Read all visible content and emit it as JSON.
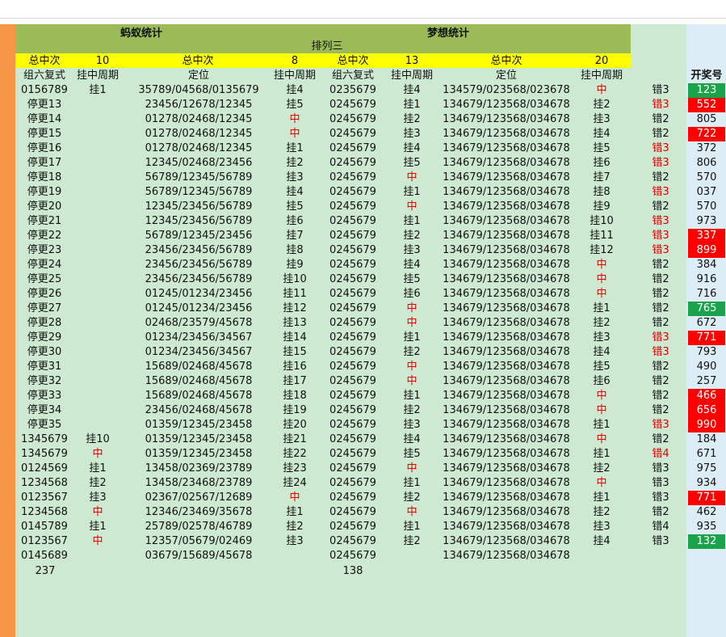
{
  "title_left": "蚂蚁统计",
  "title_right": "梦想统计",
  "subtitle": "排列三",
  "summary": {
    "left_total_label": "总中次",
    "left_total_value": "10",
    "mid_total_label": "总中次",
    "mid_total_value": "8",
    "right_total_label": "总中次",
    "right_total_value": "13",
    "far_total_label": "总中次",
    "far_total_value": "20"
  },
  "headers": [
    "组六复式",
    "挂中周期",
    "定位",
    "挂中周期",
    "组六复式",
    "挂中周期",
    "定位",
    "挂中周期",
    "",
    "开奖号"
  ],
  "rows": [
    [
      "0156789",
      "挂1",
      "35789/04568/0135679",
      "挂4",
      "0235679",
      "挂4",
      "134579/023568/023678",
      "中",
      "错3",
      "123"
    ],
    [
      "停更13",
      "",
      "23456/12678/12345",
      "挂5",
      "0245679",
      "挂1",
      "134679/123568/034678",
      "挂2",
      "错3",
      "552"
    ],
    [
      "停更14",
      "",
      "01278/02468/12345",
      "中",
      "0245679",
      "挂2",
      "134679/123568/034678",
      "挂3",
      "错2",
      "805"
    ],
    [
      "停更15",
      "",
      "01278/02468/12345",
      "中",
      "0245679",
      "挂3",
      "134679/123568/034678",
      "挂4",
      "错2",
      "722"
    ],
    [
      "停更16",
      "",
      "01278/02468/12345",
      "挂1",
      "0245679",
      "挂4",
      "134679/123568/034678",
      "挂5",
      "错3",
      "372"
    ],
    [
      "停更17",
      "",
      "12345/02468/23456",
      "挂2",
      "0245679",
      "挂5",
      "134679/123568/034678",
      "挂6",
      "错3",
      "806"
    ],
    [
      "停更18",
      "",
      "56789/12345/56789",
      "挂3",
      "0245679",
      "中",
      "134679/123568/034678",
      "挂7",
      "错2",
      "570"
    ],
    [
      "停更19",
      "",
      "56789/12345/56789",
      "挂4",
      "0245679",
      "挂1",
      "134679/123568/034678",
      "挂8",
      "错3",
      "037"
    ],
    [
      "停更20",
      "",
      "12345/23456/56789",
      "挂5",
      "0245679",
      "中",
      "134679/123568/034678",
      "挂9",
      "错2",
      "570"
    ],
    [
      "停更21",
      "",
      "12345/23456/56789",
      "挂6",
      "0245679",
      "挂1",
      "134679/123568/034678",
      "挂10",
      "错3",
      "973"
    ],
    [
      "停更22",
      "",
      "56789/12345/23456",
      "挂7",
      "0245679",
      "挂2",
      "134679/123568/034678",
      "挂11",
      "错3",
      "337"
    ],
    [
      "停更23",
      "",
      "23456/23456/56789",
      "挂8",
      "0245679",
      "挂3",
      "134679/123568/034678",
      "挂12",
      "错3",
      "899"
    ],
    [
      "停更24",
      "",
      "23456/23456/56789",
      "挂9",
      "0245679",
      "挂4",
      "134679/123568/034678",
      "中",
      "错2",
      "384"
    ],
    [
      "停更25",
      "",
      "23456/23456/56789",
      "挂10",
      "0245679",
      "挂5",
      "134679/123568/034678",
      "中",
      "错2",
      "916"
    ],
    [
      "停更26",
      "",
      "01245/01234/23456",
      "挂11",
      "0245679",
      "挂6",
      "134679/123568/034678",
      "中",
      "错2",
      "716"
    ],
    [
      "停更27",
      "",
      "01245/01234/23456",
      "挂12",
      "0245679",
      "中",
      "134679/123568/034678",
      "挂1",
      "错2",
      "765"
    ],
    [
      "停更28",
      "",
      "02468/23579/45678",
      "挂13",
      "0245679",
      "中",
      "134679/123568/034678",
      "挂2",
      "错2",
      "672"
    ],
    [
      "停更29",
      "",
      "01234/23456/34567",
      "挂14",
      "0245679",
      "挂1",
      "134679/123568/034678",
      "挂3",
      "错3",
      "771"
    ],
    [
      "停更30",
      "",
      "01234/23456/34567",
      "挂15",
      "0245679",
      "挂2",
      "134679/123568/034678",
      "挂4",
      "错3",
      "793"
    ],
    [
      "停更31",
      "",
      "15689/02468/45678",
      "挂16",
      "0245679",
      "中",
      "134679/123568/034678",
      "挂5",
      "错2",
      "490"
    ],
    [
      "停更32",
      "",
      "15689/02468/45678",
      "挂17",
      "0245679",
      "中",
      "134679/123568/034678",
      "挂6",
      "错2",
      "257"
    ],
    [
      "停更33",
      "",
      "15689/02468/45678",
      "挂18",
      "0245679",
      "挂1",
      "134679/123568/034678",
      "中",
      "错2",
      "466"
    ],
    [
      "停更34",
      "",
      "23456/02468/45678",
      "挂19",
      "0245679",
      "挂2",
      "134679/123568/034678",
      "中",
      "错2",
      "656"
    ],
    [
      "停更35",
      "",
      "01359/12345/23458",
      "挂20",
      "0245679",
      "挂3",
      "134679/123568/034678",
      "挂1",
      "错3",
      "990"
    ],
    [
      "1345679",
      "挂10",
      "01359/12345/23458",
      "挂21",
      "0245679",
      "挂4",
      "134679/123568/034678",
      "中",
      "错2",
      "184"
    ],
    [
      "1345679",
      "中",
      "01359/12345/23458",
      "挂22",
      "0245679",
      "挂5",
      "134679/123568/034678",
      "挂1",
      "错4",
      "671"
    ],
    [
      "0124569",
      "挂1",
      "13458/02369/23789",
      "挂23",
      "0245679",
      "中",
      "134679/123568/034678",
      "挂2",
      "错3",
      "975"
    ],
    [
      "1234568",
      "挂2",
      "13458/23468/23789",
      "挂24",
      "0245679",
      "挂1",
      "134679/123568/034678",
      "中",
      "错3",
      "934"
    ],
    [
      "0123567",
      "挂3",
      "02367/02567/12689",
      "中",
      "0245679",
      "挂2",
      "134679/123568/034678",
      "挂1",
      "错3",
      "771"
    ],
    [
      "1234568",
      "中",
      "12346/23469/35678",
      "挂1",
      "0245679",
      "中",
      "134679/123568/034678",
      "挂2",
      "错2",
      "462"
    ],
    [
      "0145789",
      "挂1",
      "25789/02578/46789",
      "挂2",
      "0245679",
      "挂1",
      "134679/123568/034678",
      "挂3",
      "错4",
      "935"
    ],
    [
      "0123567",
      "中",
      "12357/05679/02469",
      "挂3",
      "0245679",
      "挂2",
      "134679/123568/034678",
      "挂4",
      "错3",
      "132"
    ],
    [
      "0145689",
      "",
      "03679/15689/45678",
      "",
      "0245679",
      "",
      "134679/123568/034678",
      "",
      "",
      ""
    ]
  ],
  "footer": {
    "left_count": "237",
    "right_count": "138"
  },
  "colors": {
    "sheet_bg": "#cde9d1",
    "title_band": "#9bbb59",
    "summary_band": "#ffff00",
    "left_bar": "#f79646",
    "draw_col_bg": "#ddedf5",
    "red_cell": "#ff0000",
    "green_cell": "#1aa34a",
    "red_text": "#e00000"
  },
  "red_text_cells": [
    [
      0,
      7
    ],
    [
      1,
      8
    ],
    [
      2,
      3
    ],
    [
      3,
      3
    ],
    [
      4,
      8
    ],
    [
      5,
      8
    ],
    [
      6,
      5
    ],
    [
      7,
      8
    ],
    [
      8,
      5
    ],
    [
      9,
      8
    ],
    [
      10,
      8
    ],
    [
      11,
      8
    ],
    [
      12,
      7
    ],
    [
      13,
      7
    ],
    [
      14,
      7
    ],
    [
      15,
      5
    ],
    [
      16,
      5
    ],
    [
      17,
      8
    ],
    [
      18,
      8
    ],
    [
      19,
      5
    ],
    [
      20,
      5
    ],
    [
      21,
      7
    ],
    [
      22,
      7
    ],
    [
      23,
      8
    ],
    [
      24,
      7
    ],
    [
      25,
      1
    ],
    [
      25,
      8
    ],
    [
      26,
      5
    ],
    [
      27,
      7
    ],
    [
      28,
      3
    ],
    [
      29,
      1
    ],
    [
      29,
      5
    ],
    [
      31,
      1
    ]
  ],
  "draw_cell_fill": {
    "0": "green",
    "1": "red",
    "3": "red",
    "10": "red",
    "11": "red",
    "15": "green",
    "17": "red",
    "21": "red",
    "22": "red",
    "23": "red",
    "28": "red",
    "31": "green"
  }
}
